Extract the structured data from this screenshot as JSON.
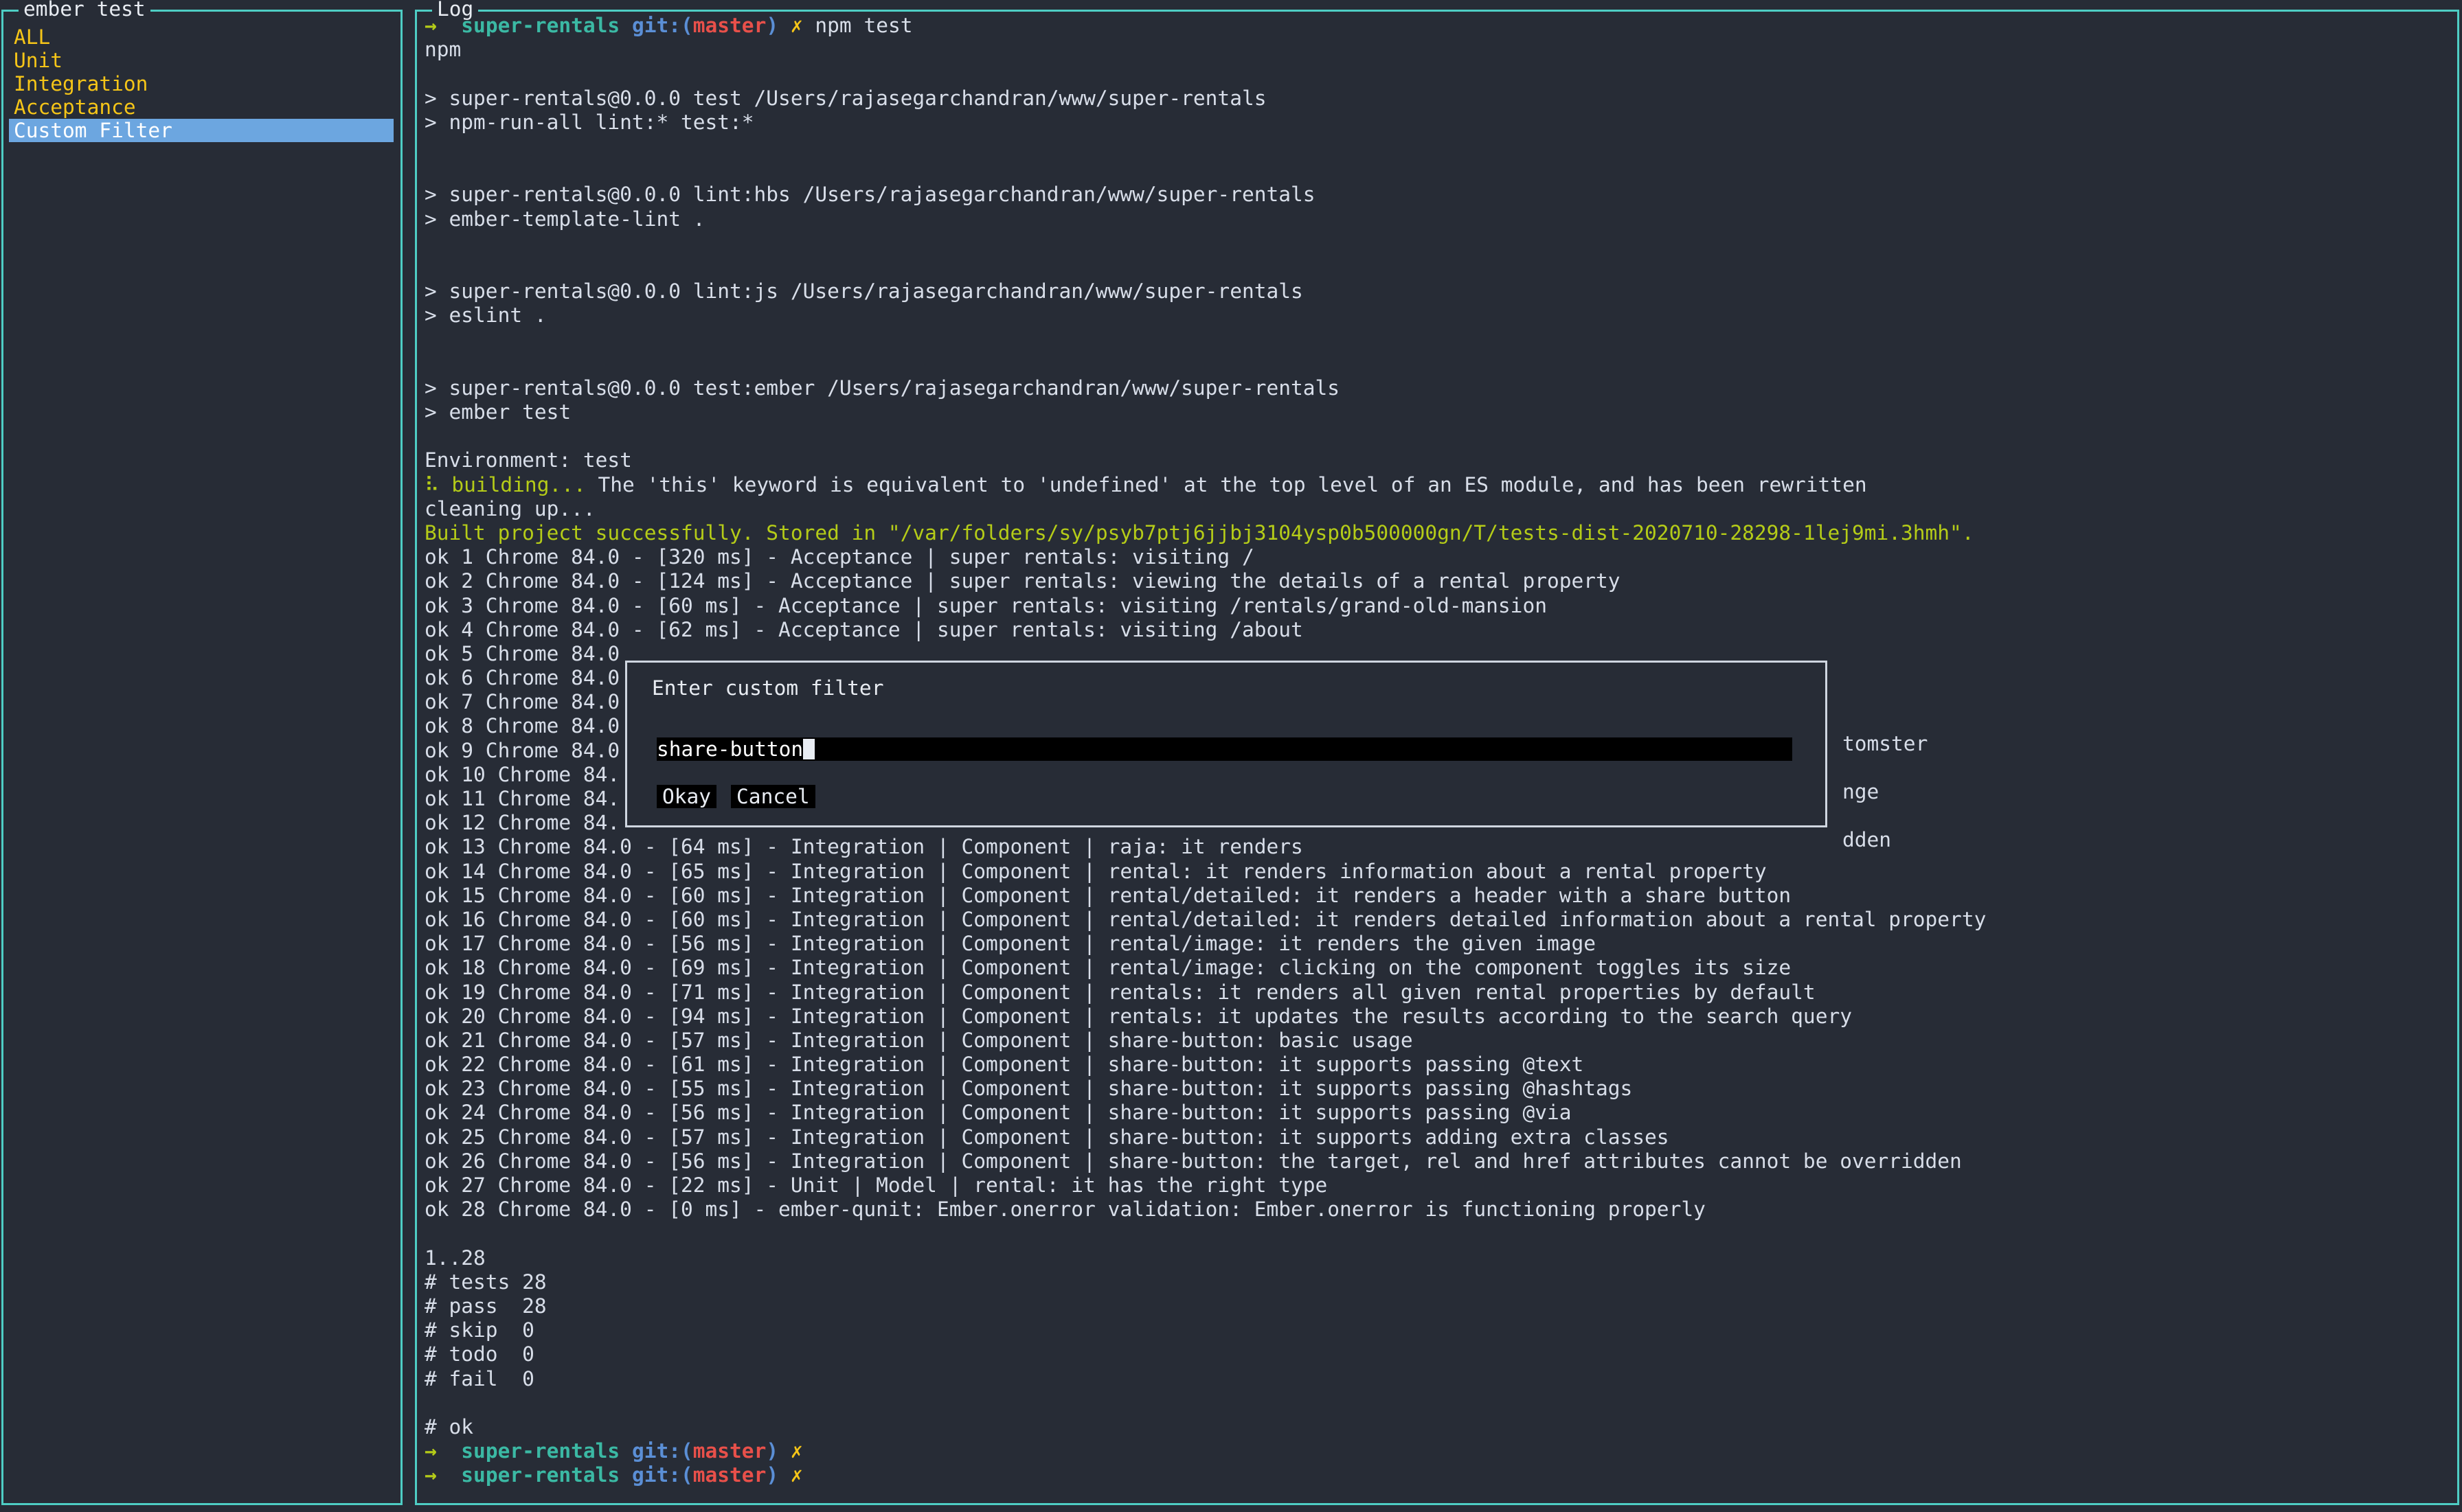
{
  "sidebar": {
    "title": "ember test",
    "items": [
      {
        "label": "ALL",
        "selected": false
      },
      {
        "label": "Unit",
        "selected": false
      },
      {
        "label": "Integration",
        "selected": false
      },
      {
        "label": "Acceptance",
        "selected": false
      },
      {
        "label": "Custom Filter",
        "selected": true
      }
    ]
  },
  "log": {
    "title": "Log",
    "prompt": {
      "arrow": "→",
      "repo": "super-rentals",
      "git_label": "git:",
      "paren_open": "(",
      "branch": "master",
      "paren_close": ")",
      "dirty_mark": "✗",
      "command": "npm test",
      "empty_command": ""
    },
    "lines": [
      "npm",
      "",
      "> super-rentals@0.0.0 test /Users/rajasegarchandran/www/super-rentals",
      "> npm-run-all lint:* test:*",
      "",
      "",
      "> super-rentals@0.0.0 lint:hbs /Users/rajasegarchandran/www/super-rentals",
      "> ember-template-lint .",
      "",
      "",
      "> super-rentals@0.0.0 lint:js /Users/rajasegarchandran/www/super-rentals",
      "> eslint .",
      "",
      "",
      "> super-rentals@0.0.0 test:ember /Users/rajasegarchandran/www/super-rentals",
      "> ember test",
      "",
      "Environment: test"
    ],
    "building_prefix": "⠧ building...",
    "building_rest": " The 'this' keyword is equivalent to 'undefined' at the top level of an ES module, and has been rewritten",
    "cleaning": "cleaning up...",
    "built": "Built project successfully. Stored in \"/var/folders/sy/psyb7ptj6jjbj3104ysp0b500000gn/T/tests-dist-2020710-28298-1lej9mi.3hmh\".",
    "results": [
      "ok 1 Chrome 84.0 - [320 ms] - Acceptance | super rentals: visiting /",
      "ok 2 Chrome 84.0 - [124 ms] - Acceptance | super rentals: viewing the details of a rental property",
      "ok 3 Chrome 84.0 - [60 ms] - Acceptance | super rentals: visiting /rentals/grand-old-mansion",
      "ok 4 Chrome 84.0 - [62 ms] - Acceptance | super rentals: visiting /about",
      "ok 5 Chrome 84.0",
      "ok 6 Chrome 84.0",
      "ok 7 Chrome 84.0",
      "ok 8 Chrome 84.0",
      "ok 9 Chrome 84.0",
      "ok 10 Chrome 84.",
      "ok 11 Chrome 84.",
      "ok 12 Chrome 84.",
      "ok 13 Chrome 84.0 - [64 ms] - Integration | Component | raja: it renders",
      "ok 14 Chrome 84.0 - [65 ms] - Integration | Component | rental: it renders information about a rental property",
      "ok 15 Chrome 84.0 - [60 ms] - Integration | Component | rental/detailed: it renders a header with a share button",
      "ok 16 Chrome 84.0 - [60 ms] - Integration | Component | rental/detailed: it renders detailed information about a rental property",
      "ok 17 Chrome 84.0 - [56 ms] - Integration | Component | rental/image: it renders the given image",
      "ok 18 Chrome 84.0 - [69 ms] - Integration | Component | rental/image: clicking on the component toggles its size",
      "ok 19 Chrome 84.0 - [71 ms] - Integration | Component | rentals: it renders all given rental properties by default",
      "ok 20 Chrome 84.0 - [94 ms] - Integration | Component | rentals: it updates the results according to the search query",
      "ok 21 Chrome 84.0 - [57 ms] - Integration | Component | share-button: basic usage",
      "ok 22 Chrome 84.0 - [61 ms] - Integration | Component | share-button: it supports passing @text",
      "ok 23 Chrome 84.0 - [55 ms] - Integration | Component | share-button: it supports passing @hashtags",
      "ok 24 Chrome 84.0 - [56 ms] - Integration | Component | share-button: it supports passing @via",
      "ok 25 Chrome 84.0 - [57 ms] - Integration | Component | share-button: it supports adding extra classes",
      "ok 26 Chrome 84.0 - [56 ms] - Integration | Component | share-button: the target, rel and href attributes cannot be overridden",
      "ok 27 Chrome 84.0 - [22 ms] - Unit | Model | rental: it has the right type",
      "ok 28 Chrome 84.0 - [0 ms] - ember-qunit: Ember.onerror validation: Ember.onerror is functioning properly"
    ],
    "occluded_tails": [
      "tomster",
      "nge",
      "dden"
    ],
    "summary": [
      "",
      "1..28",
      "# tests 28",
      "# pass  28",
      "# skip  0",
      "# todo  0",
      "# fail  0",
      "",
      "# ok"
    ]
  },
  "modal": {
    "title": "Enter custom filter",
    "input_value": "share-button",
    "input_placeholder": "",
    "ok_label": "Okay",
    "cancel_label": "Cancel"
  },
  "colors": {
    "background": "#272c36",
    "panel_border": "#4ecdc4",
    "text": "#d8dee9",
    "filter_item": "#f5c518",
    "selection_bg": "#6ca6e0",
    "green": "#b5cc18",
    "teal": "#3bb9a4",
    "blue": "#5b8fd6",
    "red": "#e8504a",
    "modal_border": "#cfd6e0",
    "input_bg": "#000000"
  }
}
